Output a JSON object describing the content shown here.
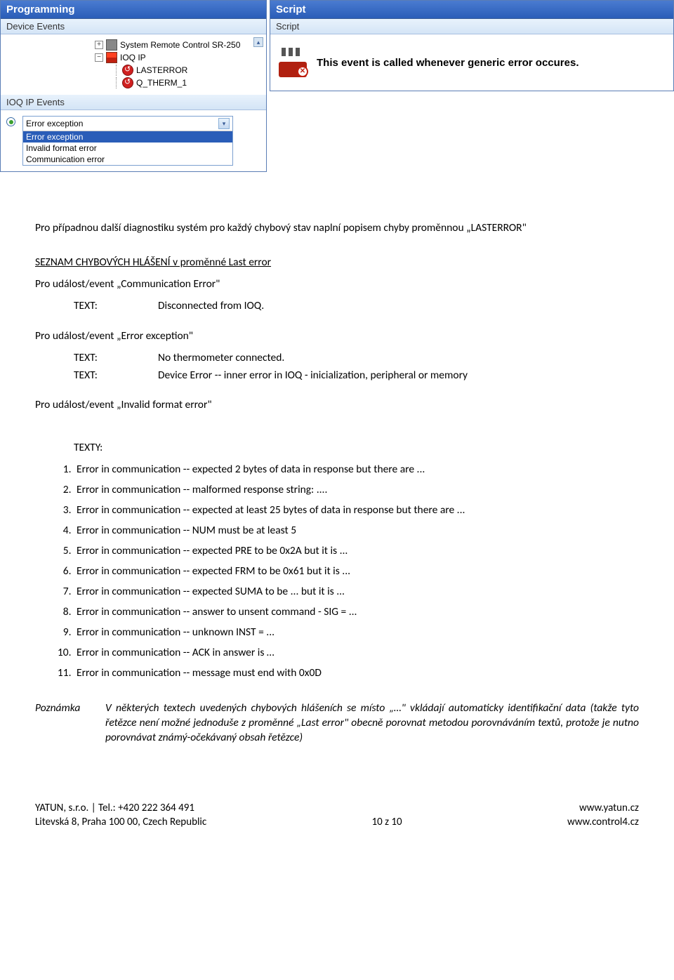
{
  "panels": {
    "programming": {
      "title": "Programming",
      "sub": "Device Events",
      "tree": {
        "node1": "System Remote Control SR-250",
        "node2": "IOQ IP",
        "node3": "LASTERROR",
        "node4": "Q_THERM_1"
      },
      "sub2": "IOQ IP Events",
      "dropdown": {
        "selected": "Error exception",
        "items": [
          "Error exception",
          "Invalid format error",
          "Communication error"
        ]
      }
    },
    "script": {
      "title": "Script",
      "sub": "Script",
      "text": "This event is called whenever generic error occures."
    }
  },
  "doc": {
    "intro": "Pro případnou další diagnostiku systém pro každý chybový stav naplní popisem chyby proměnnou „LASTERROR\"",
    "section_title": "SEZNAM CHYBOVÝCH HLÁŠENÍ v proměnné Last error",
    "ev1_title": "Pro událost/event „Communication Error\"",
    "ev1_rows": [
      {
        "label": "TEXT:",
        "value": "Disconnected from IOQ."
      }
    ],
    "ev2_title": "Pro událost/event „Error exception\"",
    "ev2_rows": [
      {
        "label": "TEXT:",
        "value": "No thermometer connected."
      },
      {
        "label": "TEXT:",
        "value": "Device Error -- inner error in IOQ - inicialization, peripheral or memory"
      }
    ],
    "ev3_title": "Pro událost/event „Invalid format error\"",
    "texty_label": "TEXTY:",
    "list": [
      "Error in communication -- expected 2 bytes of data in response but there are ...",
      "Error in communication -- malformed response string: ....",
      "Error in communication -- expected at least 25 bytes of data in response but there are ...",
      "Error in communication -- NUM must be at least 5",
      "Error in communication -- expected PRE to be 0x2A but it is ...",
      "Error in communication -- expected FRM to be 0x61 but it is ...",
      "Error in communication -- expected SUMA to be ... but it is ...",
      "Error in communication -- answer to unsent command - SIG = ...",
      "Error in communication -- unknown INST = ...",
      "Error in communication -- ACK in answer is …",
      "Error in communication -- message must end with 0x0D"
    ],
    "note_label": "Poznámka",
    "note_text": "V některých textech uvedených chybových hlášeních se místo „…\" vkládají automaticky identifikační data (takže tyto řetězce není možné jednoduše z proměnné „Last error\" obecně porovnat metodou porovnáváním textů, protože je nutno porovnávat známý-očekávaný obsah řetězce)"
  },
  "footer": {
    "left1": "YATUN, s.r.o. | Tel.: +420 222 364 491",
    "left2": "Litevská 8, Praha 100 00, Czech Republic",
    "center": "10 z 10",
    "right1": "www.yatun.cz",
    "right2": "www.control4.cz"
  }
}
